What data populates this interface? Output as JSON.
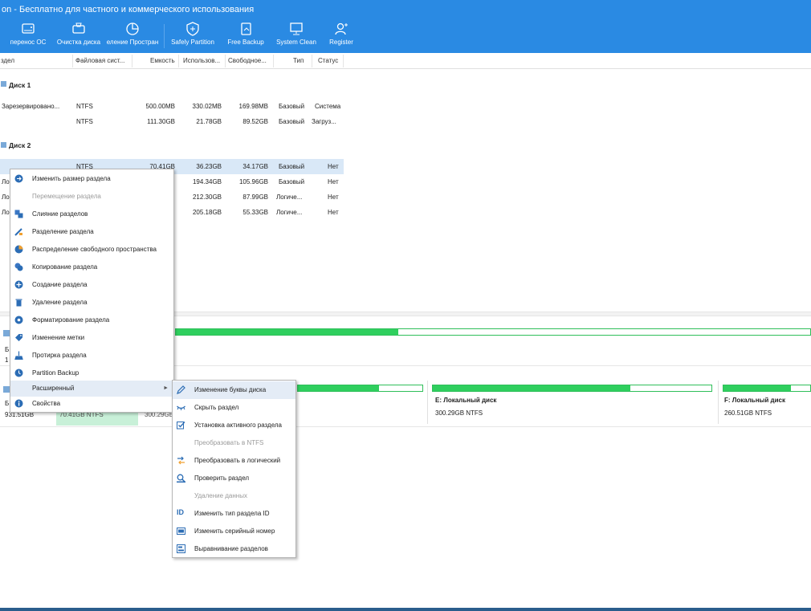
{
  "window": {
    "title": "on - Бесплатно для частного и коммерческого использования"
  },
  "toolbar": {
    "items": [
      {
        "label": "перенос ОС"
      },
      {
        "label": "Очистка диска"
      },
      {
        "label": "еление Простран"
      },
      {
        "label": "Safely Partition"
      },
      {
        "label": "Free Backup"
      },
      {
        "label": "System Clean"
      },
      {
        "label": "Register"
      }
    ]
  },
  "columns": [
    "здел",
    "Файловая сист...",
    "Емкость",
    "Использов...",
    "Свободное...",
    "Тип",
    "Статус"
  ],
  "disk1": {
    "label": "Диск 1",
    "rows": [
      {
        "name": "Зарезервировано...",
        "fs": "NTFS",
        "cap": "500.00MB",
        "used": "330.02MB",
        "free": "169.98MB",
        "type": "Базовый",
        "status": "Система"
      },
      {
        "name": "",
        "fs": "NTFS",
        "cap": "111.30GB",
        "used": "21.78GB",
        "free": "89.52GB",
        "type": "Базовый",
        "status": "Загруз..."
      }
    ]
  },
  "disk2": {
    "label": "Диск 2",
    "rows": [
      {
        "name": "",
        "fs": "NTFS",
        "cap": "70.41GB",
        "used": "36.23GB",
        "free": "34.17GB",
        "type": "Базовый",
        "status": "Нет"
      },
      {
        "name": "Ло",
        "fs": "",
        "cap": "",
        "used": "194.34GB",
        "free": "105.96GB",
        "type": "Базовый",
        "status": "Нет"
      },
      {
        "name": "Ло",
        "fs": "",
        "cap": "",
        "used": "212.30GB",
        "free": "87.99GB",
        "type": "Логиче...",
        "status": "Нет"
      },
      {
        "name": "Ло",
        "fs": "",
        "cap": "",
        "used": "205.18GB",
        "free": "55.33GB",
        "type": "Логиче...",
        "status": "Нет"
      }
    ]
  },
  "map": {
    "disk1": {
      "line1": "Б",
      "line2": "1"
    },
    "disk2": {
      "line1": "Б",
      "line2": "931.51GB",
      "first_part_size": "70.41GB NTFS",
      "second_part_size": "300.29GB"
    },
    "parts": [
      {
        "title": "E: Локальный диск",
        "size": "300.29GB NTFS",
        "fill": 0.71
      },
      {
        "title": "F: Локальный диск",
        "size": "260.51GB NTFS",
        "fill": 0.78
      }
    ],
    "disk1_fill": 0.35,
    "disk2_first_fill": 0.5,
    "disk2_second_fill": 0.65
  },
  "context_menu": {
    "items": [
      {
        "label": "Изменить размер раздела",
        "icon": "resize-icon",
        "enabled": true
      },
      {
        "label": "Перемещение раздела",
        "icon": "move-icon",
        "enabled": false
      },
      {
        "label": "Слияние разделов",
        "icon": "merge-icon",
        "enabled": true
      },
      {
        "label": "Разделение раздела",
        "icon": "split-icon",
        "enabled": true
      },
      {
        "label": "Распределение свободного пространства",
        "icon": "allocate-icon",
        "enabled": true
      },
      {
        "label": "Копирование раздела",
        "icon": "copy-icon",
        "enabled": true
      },
      {
        "label": "Создание раздела",
        "icon": "create-icon",
        "enabled": true
      },
      {
        "label": "Удаление раздела",
        "icon": "trash-icon",
        "enabled": true
      },
      {
        "label": "Форматирование раздела",
        "icon": "format-icon",
        "enabled": true
      },
      {
        "label": "Изменение метки",
        "icon": "tag-icon",
        "enabled": true
      },
      {
        "label": "Протирка раздела",
        "icon": "wipe-icon",
        "enabled": true
      },
      {
        "label": "Partition Backup",
        "icon": "backup-icon",
        "enabled": true
      },
      {
        "label": "Расширенный",
        "icon": "",
        "enabled": true,
        "submenu": true
      },
      {
        "label": "Свойства",
        "icon": "info-icon",
        "enabled": true
      }
    ]
  },
  "submenu": {
    "items": [
      {
        "label": "Изменение буквы диска",
        "icon": "pencil-icon",
        "enabled": true
      },
      {
        "label": "Скрыть раздел",
        "icon": "hide-icon",
        "enabled": true
      },
      {
        "label": "Установка активного раздела",
        "icon": "check-icon",
        "enabled": true
      },
      {
        "label": "Преобразовать в NTFS",
        "icon": "",
        "enabled": false
      },
      {
        "label": "Преобразовать в логический",
        "icon": "convert-icon",
        "enabled": true
      },
      {
        "label": "Проверить раздел",
        "icon": "check-partition-icon",
        "enabled": true
      },
      {
        "label": "Удаление данных",
        "icon": "",
        "enabled": false
      },
      {
        "label": "Изменить тип раздела ID",
        "icon": "id-icon",
        "enabled": true
      },
      {
        "label": "Изменить серийный номер",
        "icon": "serial-icon",
        "enabled": true
      },
      {
        "label": "Выравнивание разделов",
        "icon": "align-icon",
        "enabled": true
      }
    ]
  }
}
